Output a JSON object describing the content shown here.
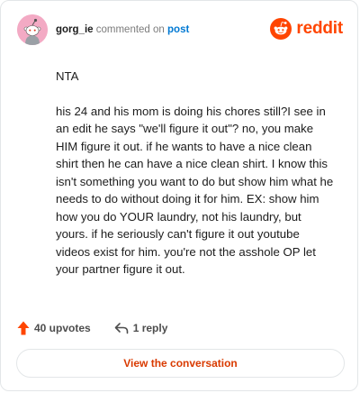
{
  "header": {
    "username": "gorg_ie",
    "action_text": "commented on",
    "post_link": "post",
    "brand": "reddit",
    "avatar_icon": "snoo-avatar-icon",
    "brand_icon": "reddit-logo-icon"
  },
  "comment": {
    "paragraphs": [
      "NTA",
      "his 24 and his mom is doing his chores still?I see in an edit he says \"we'll figure it out\"? no, you make HIM figure it out. if he wants to have a nice clean shirt then he can have a nice clean shirt. I know this isn't something you want to do but show him what he needs to do without doing it for him. EX: show him how you do YOUR laundry, not his laundry, but yours. if he seriously can't figure it out youtube videos exist for him. you're not the asshole OP let your partner figure it out."
    ]
  },
  "actions": {
    "upvotes": "40 upvotes",
    "replies": "1 reply",
    "upvote_icon": "upvote-arrow-icon",
    "reply_icon": "reply-arrow-icon"
  },
  "footer": {
    "view_label": "View the conversation"
  },
  "colors": {
    "brand": "#ff4500",
    "link": "#0079d3",
    "avatar_bg": "#f3aac4",
    "button_text": "#d93a00"
  }
}
